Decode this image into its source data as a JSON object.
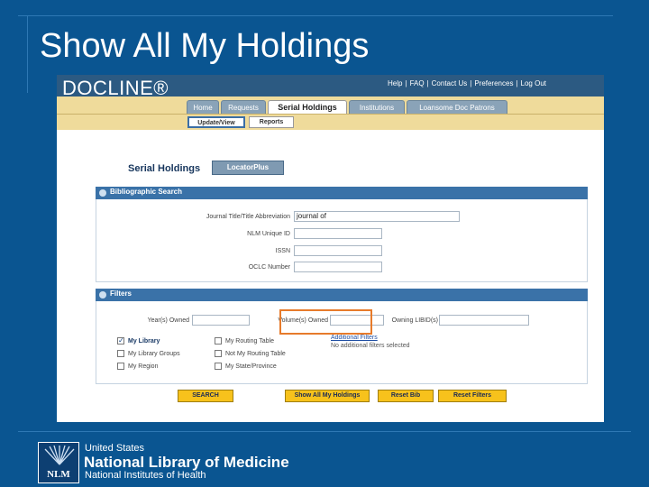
{
  "slide": {
    "title": "Show All My Holdings"
  },
  "app": {
    "logo": "DOCLINE®",
    "top_links": [
      "Help",
      "FAQ",
      "Contact Us",
      "Preferences",
      "Log Out"
    ],
    "tabs": [
      "Home",
      "Requests",
      "Serial Holdings",
      "Institutions",
      "Loansome Doc Patrons"
    ],
    "active_tab": "Serial Holdings",
    "subtabs": [
      "Update/View",
      "Reports"
    ],
    "active_subtab": "Update/View"
  },
  "page": {
    "title": "Serial Holdings",
    "locator_button": "LocatorPlus"
  },
  "bibliographic_search": {
    "header": "Bibliographic Search",
    "fields": {
      "journal_title_label": "Journal Title/Title Abbreviation",
      "journal_title_value": "journal of",
      "nlm_id_label": "NLM Unique ID",
      "nlm_id_value": "",
      "issn_label": "ISSN",
      "issn_value": "",
      "oclc_label": "OCLC Number",
      "oclc_value": ""
    }
  },
  "filters": {
    "header": "Filters",
    "years_owned_label": "Year(s) Owned",
    "years_owned_value": "",
    "volumes_owned_label": "Volume(s) Owned",
    "volumes_owned_value": "",
    "owning_libid_label": "Owning LIBID(s)",
    "owning_libid_value": "",
    "checkboxes": [
      {
        "label": "My Library",
        "checked": true
      },
      {
        "label": "My Library Groups",
        "checked": false
      },
      {
        "label": "My Region",
        "checked": false
      },
      {
        "label": "My Routing Table",
        "checked": false
      },
      {
        "label": "Not My Routing Table",
        "checked": false
      },
      {
        "label": "My State/Province",
        "checked": false
      }
    ],
    "additional_filters_link": "Additional Filters",
    "additional_filters_note": "No additional filters selected"
  },
  "buttons": {
    "search": "SEARCH",
    "show_all": "Show All My Holdings",
    "reset_bib": "Reset Bib",
    "reset_filters": "Reset Filters"
  },
  "footer": {
    "badge": "NLM",
    "line1": "United States",
    "line2": "National Library of Medicine",
    "line3": "National Institutes of Health"
  },
  "colors": {
    "slide_background": "#0a5591",
    "docline_header": "#2c5a82",
    "tab_bar": "#efdb9b",
    "section_bar": "#3a72a8",
    "action_button": "#f7c21c",
    "callout": "#e77b2b"
  }
}
